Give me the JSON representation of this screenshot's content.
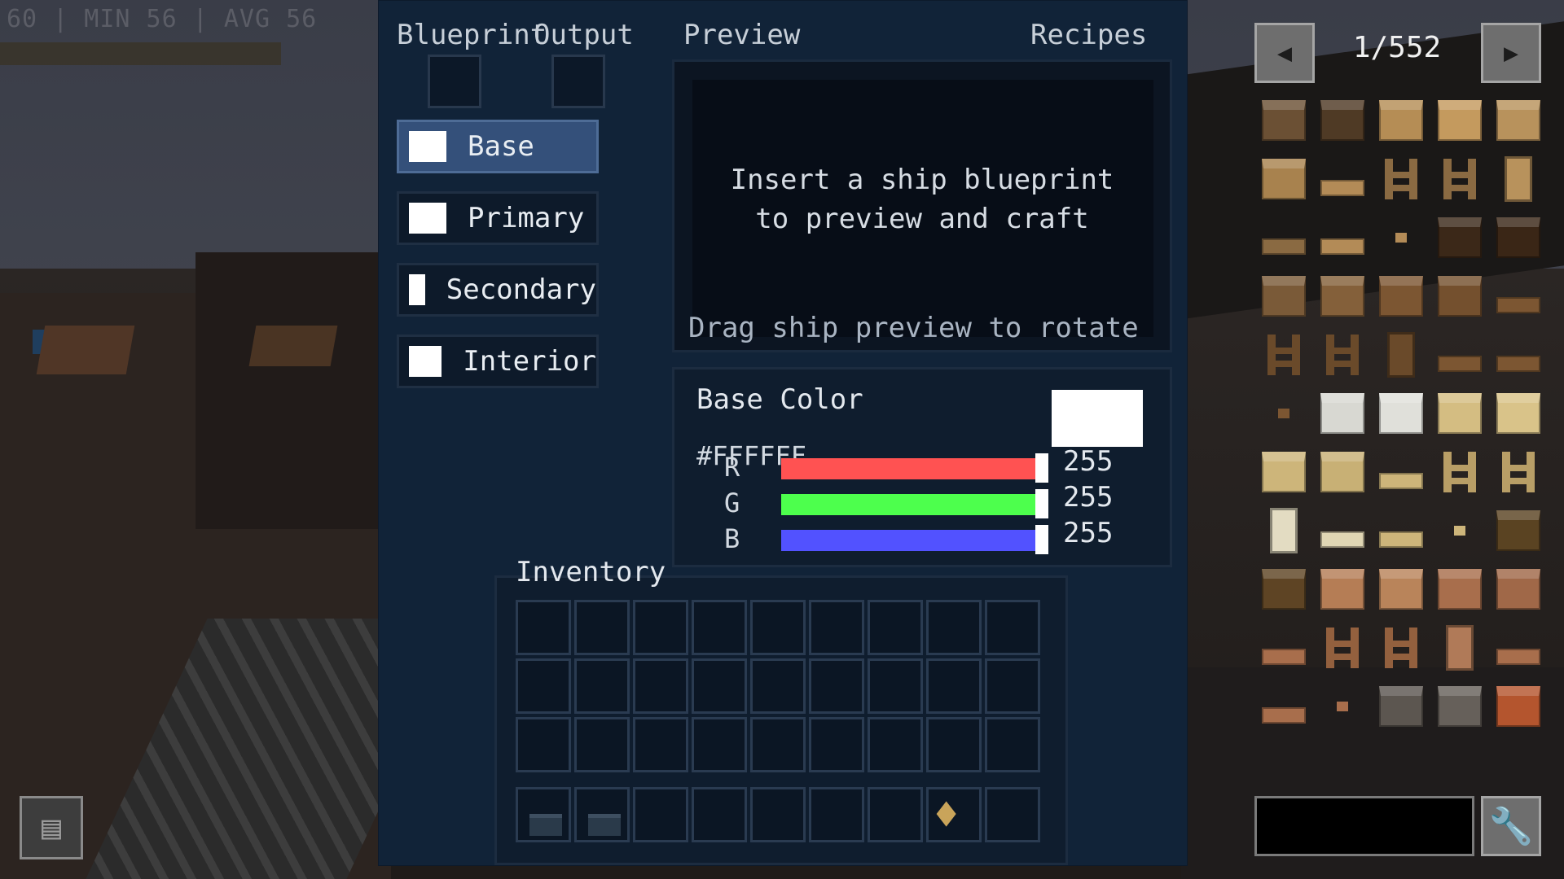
{
  "hud": {
    "fps": "60 | MIN 56 | AVG 56"
  },
  "panel": {
    "header_blueprint": "Blueprint",
    "header_output": "Output",
    "header_preview": "Preview",
    "header_recipes": "Recipes",
    "layers": [
      {
        "label": "Base",
        "color": "#FFFFFF",
        "active": true
      },
      {
        "label": "Primary",
        "color": "#FFFFFF",
        "active": false
      },
      {
        "label": "Secondary",
        "color": "#FFFFFF",
        "active": false
      },
      {
        "label": "Interior",
        "color": "#FFFFFF",
        "active": false
      }
    ],
    "preview_message": "Insert a ship blueprint\nto preview and craft",
    "preview_hint": "Drag ship preview to rotate",
    "color": {
      "title": "Base Color",
      "hex": "#FFFFFF",
      "r_label": "R",
      "r_value": "255",
      "r_color": "#ff5252",
      "g_label": "G",
      "g_value": "255",
      "g_color": "#4dff4d",
      "b_label": "B",
      "b_value": "255",
      "b_color": "#5252ff"
    },
    "inventory_title": "Inventory"
  },
  "recipes": {
    "page": "1/552",
    "prev_icon": "left-arrow-icon",
    "next_icon": "right-arrow-icon",
    "search_placeholder": "",
    "config_icon": "wrench-icon"
  },
  "recipe_items": [
    {
      "name": "oak-log",
      "kind": "blk",
      "color": "#6b5034"
    },
    {
      "name": "dark-log",
      "kind": "blk",
      "color": "#4f3a25"
    },
    {
      "name": "stripped-log",
      "kind": "blk",
      "color": "#b58d55"
    },
    {
      "name": "stripped-wood",
      "kind": "blk",
      "color": "#c49a5e"
    },
    {
      "name": "planks",
      "kind": "blk",
      "color": "#b8925c"
    },
    {
      "name": "stairs",
      "kind": "blk",
      "color": "#a8824e"
    },
    {
      "name": "slab",
      "kind": "slab",
      "color": "#b38b57"
    },
    {
      "name": "fence",
      "kind": "fence",
      "color": "#8a6a42"
    },
    {
      "name": "fence-gate",
      "kind": "fence",
      "color": "#8a6a42"
    },
    {
      "name": "door",
      "kind": "door",
      "color": "#b8925c"
    },
    {
      "name": "trapdoor",
      "kind": "slab",
      "color": "#8a6a42"
    },
    {
      "name": "pressure-plate",
      "kind": "slab",
      "color": "#b38b57"
    },
    {
      "name": "button",
      "kind": "small",
      "color": "#b38b57"
    },
    {
      "name": "dark-log-2",
      "kind": "blk",
      "color": "#3b2818"
    },
    {
      "name": "dark-wood",
      "kind": "blk",
      "color": "#3a2616"
    },
    {
      "name": "spruce-log",
      "kind": "blk",
      "color": "#7a5a38"
    },
    {
      "name": "spruce-wood",
      "kind": "blk",
      "color": "#84603a"
    },
    {
      "name": "spruce-planks",
      "kind": "blk",
      "color": "#7c5632"
    },
    {
      "name": "spruce-stairs",
      "kind": "blk",
      "color": "#74502e"
    },
    {
      "name": "spruce-slab",
      "kind": "slab",
      "color": "#7c5632"
    },
    {
      "name": "spruce-fence",
      "kind": "fence",
      "color": "#6a4a2a"
    },
    {
      "name": "spruce-gate",
      "kind": "fence",
      "color": "#6a4a2a"
    },
    {
      "name": "spruce-door",
      "kind": "door",
      "color": "#6a4a2a"
    },
    {
      "name": "spruce-trapdoor",
      "kind": "slab",
      "color": "#7c5632"
    },
    {
      "name": "spruce-plate",
      "kind": "slab",
      "color": "#7c5632"
    },
    {
      "name": "spruce-button",
      "kind": "small",
      "color": "#7c5632"
    },
    {
      "name": "birch-log",
      "kind": "blk",
      "color": "#d8d8d2"
    },
    {
      "name": "birch-wood",
      "kind": "blk",
      "color": "#e0e0da"
    },
    {
      "name": "birch-stripped",
      "kind": "blk",
      "color": "#d4bd82"
    },
    {
      "name": "birch-stripped-wood",
      "kind": "blk",
      "color": "#d9c389"
    },
    {
      "name": "birch-planks",
      "kind": "blk",
      "color": "#cdb57a"
    },
    {
      "name": "birch-stairs",
      "kind": "blk",
      "color": "#c8b075"
    },
    {
      "name": "birch-slab",
      "kind": "slab",
      "color": "#cdb57a"
    },
    {
      "name": "birch-fence",
      "kind": "fence",
      "color": "#b89e66"
    },
    {
      "name": "birch-gate",
      "kind": "fence",
      "color": "#b89e66"
    },
    {
      "name": "birch-door",
      "kind": "door",
      "color": "#e3dcc2"
    },
    {
      "name": "birch-trapdoor",
      "kind": "slab",
      "color": "#e0d6b4"
    },
    {
      "name": "birch-plate",
      "kind": "slab",
      "color": "#cdb57a"
    },
    {
      "name": "birch-button",
      "kind": "small",
      "color": "#cdb57a"
    },
    {
      "name": "jungle-log",
      "kind": "blk",
      "color": "#5a4322"
    },
    {
      "name": "jungle-wood",
      "kind": "blk",
      "color": "#5e4424"
    },
    {
      "name": "jungle-stripped",
      "kind": "blk",
      "color": "#b57d55"
    },
    {
      "name": "jungle-stripped-wood",
      "kind": "blk",
      "color": "#b9845a"
    },
    {
      "name": "jungle-planks",
      "kind": "blk",
      "color": "#a86e4c"
    },
    {
      "name": "jungle-stairs",
      "kind": "blk",
      "color": "#a06848"
    },
    {
      "name": "jungle-slab",
      "kind": "slab",
      "color": "#a86e4c"
    },
    {
      "name": "jungle-fence",
      "kind": "fence",
      "color": "#93603e"
    },
    {
      "name": "jungle-gate",
      "kind": "fence",
      "color": "#93603e"
    },
    {
      "name": "jungle-door",
      "kind": "door",
      "color": "#b07a58"
    },
    {
      "name": "jungle-trapdoor",
      "kind": "slab",
      "color": "#a86e4c"
    },
    {
      "name": "jungle-plate",
      "kind": "slab",
      "color": "#a86e4c"
    },
    {
      "name": "jungle-button",
      "kind": "small",
      "color": "#a86e4c"
    },
    {
      "name": "acacia-log",
      "kind": "blk",
      "color": "#5c5650"
    },
    {
      "name": "acacia-wood",
      "kind": "blk",
      "color": "#66605a"
    },
    {
      "name": "acacia-stripped",
      "kind": "blk",
      "color": "#b4552e"
    }
  ]
}
